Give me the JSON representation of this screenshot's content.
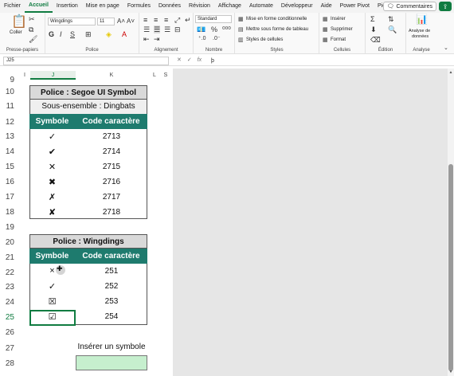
{
  "menu": {
    "tabs": [
      "Fichier",
      "Accueil",
      "Insertion",
      "Mise en page",
      "Formules",
      "Données",
      "Révision",
      "Affichage",
      "Automate",
      "Développeur",
      "Aide",
      "Power Pivot",
      "Pierre"
    ],
    "comments_label": "Commentaires"
  },
  "ribbon": {
    "clipboard": {
      "paste_label": "Coller",
      "group_label": "Presse-papiers"
    },
    "font": {
      "font_name": "Wingdings",
      "font_size": "11",
      "bold": "G",
      "italic": "I",
      "underline": "S",
      "group_label": "Police"
    },
    "alignment": {
      "group_label": "Alignement"
    },
    "number": {
      "format": "Standard",
      "percent": "%",
      "group_label": "Nombre"
    },
    "styles": {
      "conditional": "Mise en forme conditionnelle",
      "table": "Mettre sous forme de tableau",
      "cell_styles": "Styles de cellules",
      "group_label": "Styles"
    },
    "cells": {
      "insert": "Insérer",
      "delete": "Supprimer",
      "format": "Format",
      "group_label": "Cellules"
    },
    "editing": {
      "group_label": "Édition"
    },
    "analysis": {
      "button_line1": "Analyse de",
      "button_line2": "données",
      "group_label": "Analyse"
    }
  },
  "formula_bar": {
    "name_box": "J25",
    "fx": "fx",
    "value": "þ"
  },
  "columns": [
    "I",
    "J",
    "K",
    "L",
    "S"
  ],
  "rows": [
    "9",
    "10",
    "11",
    "12",
    "13",
    "14",
    "15",
    "16",
    "17",
    "18",
    "19",
    "20",
    "21",
    "22",
    "23",
    "24",
    "25",
    "26",
    "27",
    "28"
  ],
  "table1": {
    "title": "Police : Segoe UI Symbol",
    "subtitle": "Sous-ensemble : Dingbats",
    "headers": [
      "Symbole",
      "Code caractère"
    ],
    "rows": [
      {
        "symbol": "✓",
        "code": "2713"
      },
      {
        "symbol": "✔",
        "code": "2714"
      },
      {
        "symbol": "✕",
        "code": "2715"
      },
      {
        "symbol": "✖",
        "code": "2716"
      },
      {
        "symbol": "✗",
        "code": "2717"
      },
      {
        "symbol": "✘",
        "code": "2718"
      }
    ]
  },
  "table2": {
    "title": "Police : Wingdings",
    "headers": [
      "Symbole",
      "Code caractère"
    ],
    "rows": [
      {
        "symbol": "×",
        "code": "251"
      },
      {
        "symbol": "✓",
        "code": "252"
      },
      {
        "symbol": "☒",
        "code": "253"
      },
      {
        "symbol": "☑",
        "code": "254"
      }
    ]
  },
  "insert_symbol_label": "Insérer un symbole"
}
